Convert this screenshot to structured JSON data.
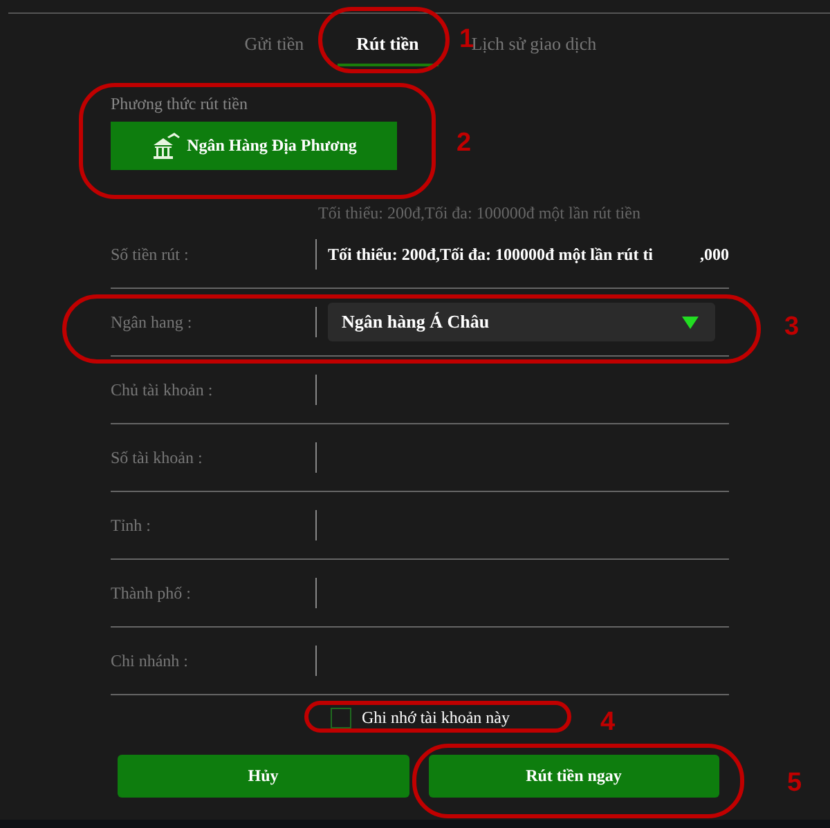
{
  "tabs": [
    {
      "label": "Gửi tiền",
      "selected": false
    },
    {
      "label": "Rút tiền",
      "selected": true
    },
    {
      "label": "Lịch sử giao dịch",
      "selected": false
    }
  ],
  "method": {
    "label": "Phương thức rút tiền",
    "button": "Ngân Hàng Địa Phương"
  },
  "hint": "Tối thiểu: 200đ,Tối đa: 100000đ một lần rút tiền",
  "fields": [
    {
      "kind": "amount",
      "label": "Số tiền rút :",
      "placeholder": "Tối thiểu: 200đ,Tối đa: 100000đ một lần rút ti",
      "suffix": ",000"
    },
    {
      "kind": "select",
      "label": "Ngân hang :",
      "value": "Ngân hàng Á Châu"
    },
    {
      "kind": "text",
      "label": "Chủ tài khoản :"
    },
    {
      "kind": "text",
      "label": "Số tài khoản :"
    },
    {
      "kind": "text",
      "label": "Tỉnh :"
    },
    {
      "kind": "text",
      "label": "Thành phố :"
    },
    {
      "kind": "text",
      "label": "Chi nhánh :"
    }
  ],
  "remember": {
    "label": "Ghi nhớ tài khoản này",
    "checked": false
  },
  "buttons": [
    "Hủy",
    "Rút tiền ngay"
  ],
  "annotations": [
    "1",
    "2",
    "3",
    "4",
    "5"
  ]
}
